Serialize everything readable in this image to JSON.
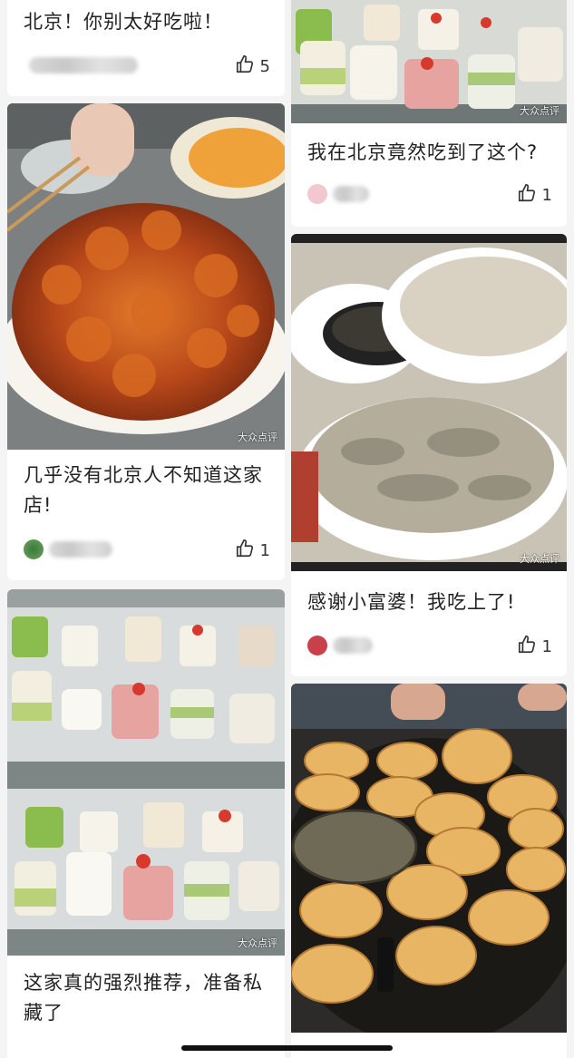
{
  "feed": [
    {
      "title": "北京！你别太好吃啦！",
      "likes": "5"
    },
    {
      "title": "我在北京竟然吃到了这个?",
      "likes": "1",
      "watermark": "大众点评"
    },
    {
      "title": "几乎没有北京人不知道这家店!",
      "likes": "1",
      "watermark": "大众点评"
    },
    {
      "title": "感谢小富婆！我吃上了!",
      "likes": "1",
      "watermark": "大众点评"
    },
    {
      "title": "这家真的强烈推荐，准备私藏了",
      "watermark": "大众点评"
    },
    {
      "watermark": ""
    }
  ],
  "icons": {
    "like": "thumbs-up-icon"
  },
  "colors": {
    "background": "#f4f4f4",
    "card": "#ffffff",
    "text": "#222222"
  }
}
